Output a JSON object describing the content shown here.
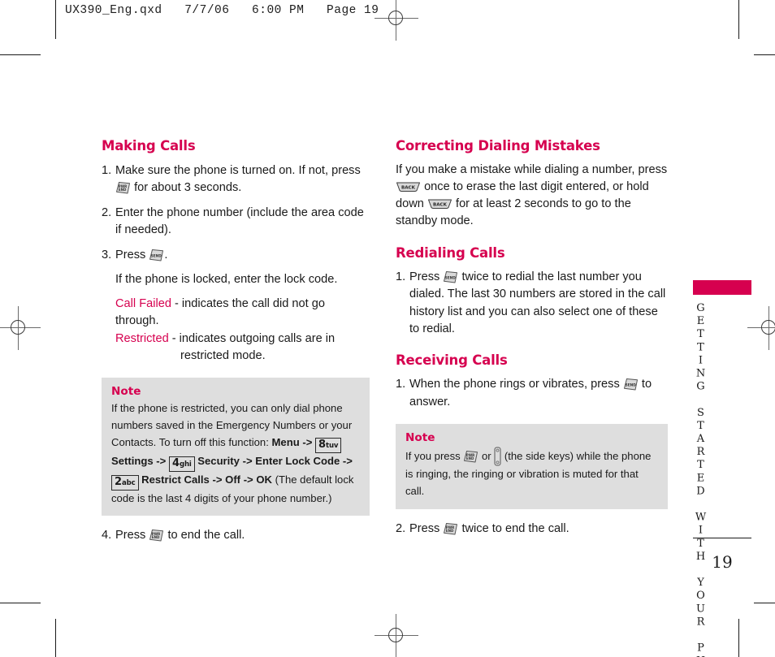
{
  "printer_slug": "UX390_Eng.qxd   7/7/06   6:00 PM   Page 19",
  "colors": {
    "accent_pink": "#d6004f",
    "note_background": "#dedede",
    "body_text": "#1a1a1a"
  },
  "left_column": {
    "heading": "Making Calls",
    "step1_num": "1.",
    "step1_text_a": "Make sure the phone is turned on. If not, press",
    "step1_text_b": "for about 3 seconds.",
    "step2_num": "2.",
    "step2_text": "Enter the phone number (include the area code if needed).",
    "step3_num": "3.",
    "step3_text_a": "Press",
    "step3_text_b": ".",
    "step3_sub": "If the phone is locked, enter the lock code.",
    "status_call_failed_label": "Call Failed",
    "status_call_failed_text": "- indicates the call did not go through.",
    "status_restricted_label": "Restricted",
    "status_restricted_text": "- indicates outgoing calls are in",
    "status_restricted_text2": "restricted mode.",
    "note": {
      "title": "Note",
      "text_1": "If the phone is restricted, you can only dial phone numbers saved in the Emergency Numbers or your Contacts. To turn off this function:",
      "menu": "Menu",
      "arrow": "->",
      "key_8_digit": "8",
      "key_8_letters": "tuv",
      "settings": "Settings",
      "key_4_digit": "4",
      "key_4_letters": "ghi",
      "security": "Security",
      "enter_lock_code": "Enter Lock Code",
      "key_2_digit": "2",
      "key_2_letters": "abc",
      "restrict_calls": "Restrict Calls",
      "off": "Off",
      "ok": "OK",
      "text_2": "(The default lock code is the last 4 digits of your phone number.)"
    },
    "step4_num": "4.",
    "step4_text_a": "Press",
    "step4_text_b": "to end the call."
  },
  "right_column": {
    "heading_1": "Correcting Dialing Mistakes",
    "para_1_a": "If you make a mistake while dialing a number, press",
    "para_1_b": "once to erase the last digit entered, or hold down",
    "para_1_c": "for at least 2 seconds to go to the standby mode.",
    "heading_2": "Redialing Calls",
    "redial_num": "1.",
    "redial_text_a": "Press",
    "redial_text_b": "twice to redial the last number you dialed. The last 30 numbers are stored in the call history list and you can also select one of these to redial.",
    "heading_3": "Receiving Calls",
    "receive_num": "1.",
    "receive_text_a": "When the phone rings or vibrates, press",
    "receive_text_b": "to answer.",
    "note": {
      "title": "Note",
      "text_a": "If you press",
      "text_or": "or",
      "text_b": "(the side keys) while the phone is ringing, the ringing or vibration is muted for that call."
    },
    "end_num": "2.",
    "end_text_a": "Press",
    "end_text_b": "twice to end the call."
  },
  "sidebar": {
    "chapter_label": "GETTING STARTED WITH YOUR PHONE",
    "page_number": "19"
  },
  "icons": {
    "end_key": "end-key-icon",
    "send_key": "send-key-icon",
    "back_key": "back-key-icon",
    "side_keys": "side-keys-icon"
  }
}
